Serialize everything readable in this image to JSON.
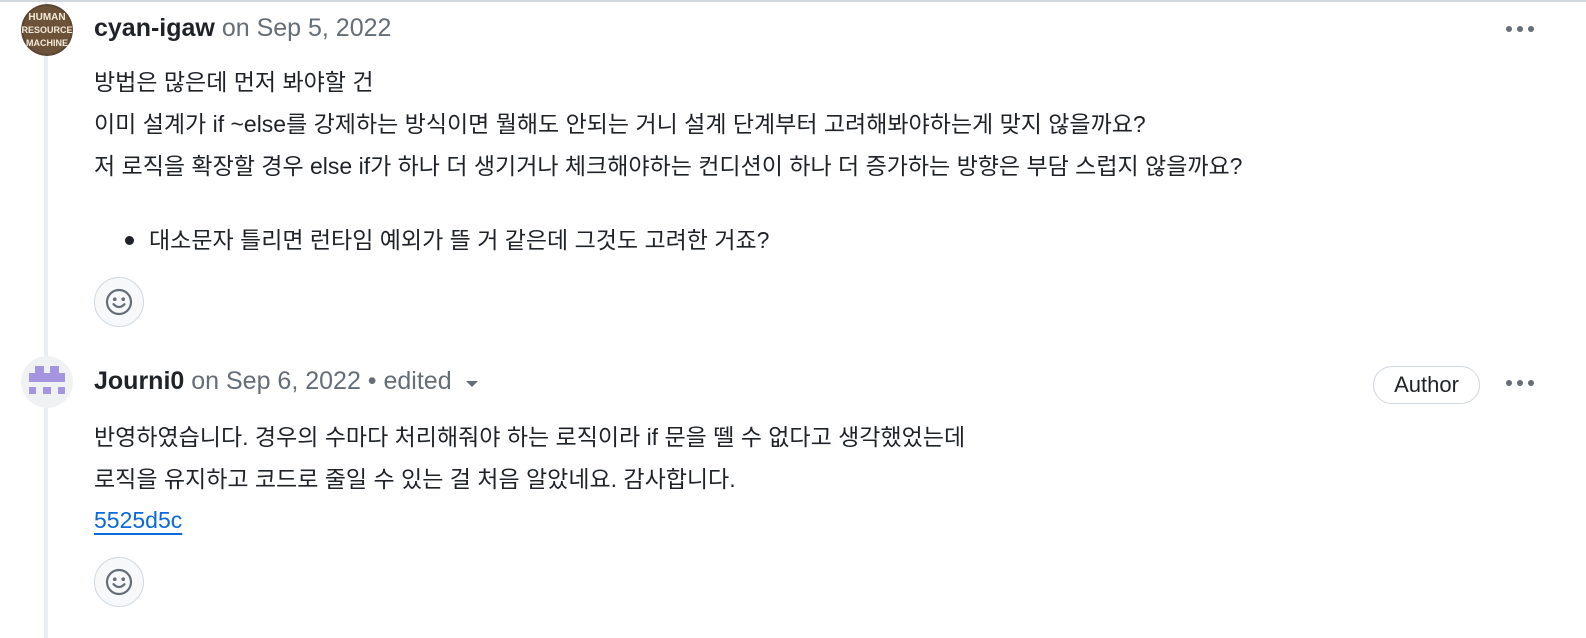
{
  "comments": [
    {
      "author": "cyan-igaw",
      "date": "on Sep 5, 2022",
      "avatar_text": [
        "HUMAN",
        "RESOURCE",
        "MACHINE"
      ],
      "lines": [
        "방법은 많은데 먼저 봐야할 건",
        "이미 설계가 if ~else를 강제하는 방식이면 뭘해도 안되는 거니 설계 단계부터 고려해봐야하는게 맞지 않을까요?",
        "저 로직을 확장할 경우 else if가 하나 더 생기거나 체크해야하는 컨디션이 하나 더 증가하는 방향은 부담 스럽지 않을까요?"
      ],
      "bullets": [
        "대소문자 틀리면 런타임 예외가 뜰 거 같은데 그것도 고려한 거죠?"
      ]
    },
    {
      "author": "Journi0",
      "date": "on Sep 6, 2022",
      "edited": "• edited",
      "badge": "Author",
      "lines": [
        "반영하였습니다. 경우의 수마다 처리해줘야 하는 로직이라 if 문을 뗄 수 없다고 생각했었는데",
        "로직을 유지하고 코드로 줄일 수 있는 걸 처음 알았네요. 감사합니다."
      ],
      "commit": "5525d5c"
    }
  ],
  "colors": {
    "link": "#0969da",
    "muted": "#656d76",
    "text": "#1f2328",
    "border": "#d0d7de",
    "identicon": "#a594e0"
  },
  "icons": {
    "menu": "kebab-horizontal-icon",
    "reaction": "smiley-icon",
    "edited": "triangle-down-icon"
  }
}
